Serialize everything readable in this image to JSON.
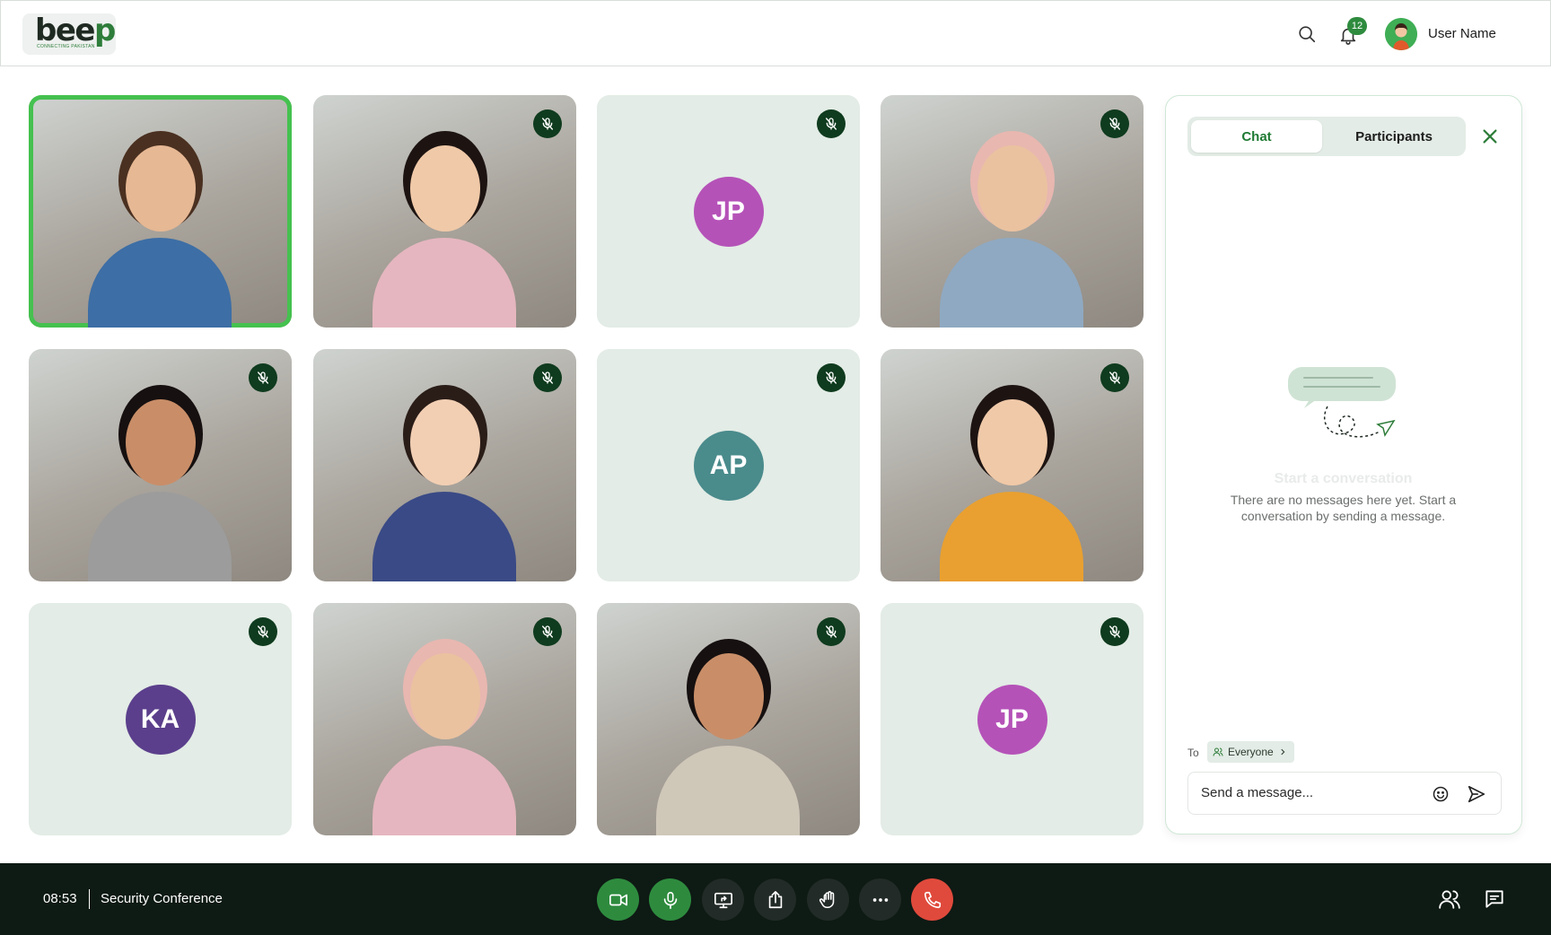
{
  "brand": {
    "logo_word": "beep",
    "logo_tagline": "CONNECTING PAKISTAN"
  },
  "header": {
    "notification_count": "12",
    "user_name": "User Name"
  },
  "participants": [
    {
      "kind": "photo",
      "name": "speaker",
      "speaking": true,
      "muted": false
    },
    {
      "kind": "photo",
      "name": "participant-2",
      "speaking": false,
      "muted": true
    },
    {
      "kind": "initials",
      "initials": "JP",
      "color": "#b552b8",
      "muted": true
    },
    {
      "kind": "photo",
      "name": "participant-4",
      "speaking": false,
      "muted": true
    },
    {
      "kind": "photo",
      "name": "participant-5",
      "speaking": false,
      "muted": true
    },
    {
      "kind": "photo",
      "name": "participant-6",
      "speaking": false,
      "muted": true
    },
    {
      "kind": "initials",
      "initials": "AP",
      "color": "#4a8b8c",
      "muted": true
    },
    {
      "kind": "photo",
      "name": "participant-8",
      "speaking": false,
      "muted": true
    },
    {
      "kind": "initials",
      "initials": "KA",
      "color": "#5b3f8c",
      "muted": true
    },
    {
      "kind": "photo",
      "name": "participant-10",
      "speaking": false,
      "muted": true
    },
    {
      "kind": "photo",
      "name": "participant-11",
      "speaking": false,
      "muted": true
    },
    {
      "kind": "initials",
      "initials": "JP",
      "color": "#b552b8",
      "muted": true
    }
  ],
  "chat": {
    "tabs": {
      "chat": "Chat",
      "participants": "Participants"
    },
    "empty_title": "Start a conversation",
    "empty_text": "There are no messages here yet. Start a conversation by sending a message.",
    "to_label": "To",
    "recipient": "Everyone",
    "message_placeholder": "Send a message..."
  },
  "meeting": {
    "time": "08:53",
    "title": "Security Conference"
  },
  "controls": [
    "video-toggle",
    "mic-toggle",
    "screen-share",
    "share",
    "raise-hand",
    "more",
    "end-call"
  ],
  "colors": {
    "accent": "#2e8b3e",
    "speaking_border": "#45c14f",
    "end_call": "#e04a3c",
    "bar": "#0e1a14"
  }
}
